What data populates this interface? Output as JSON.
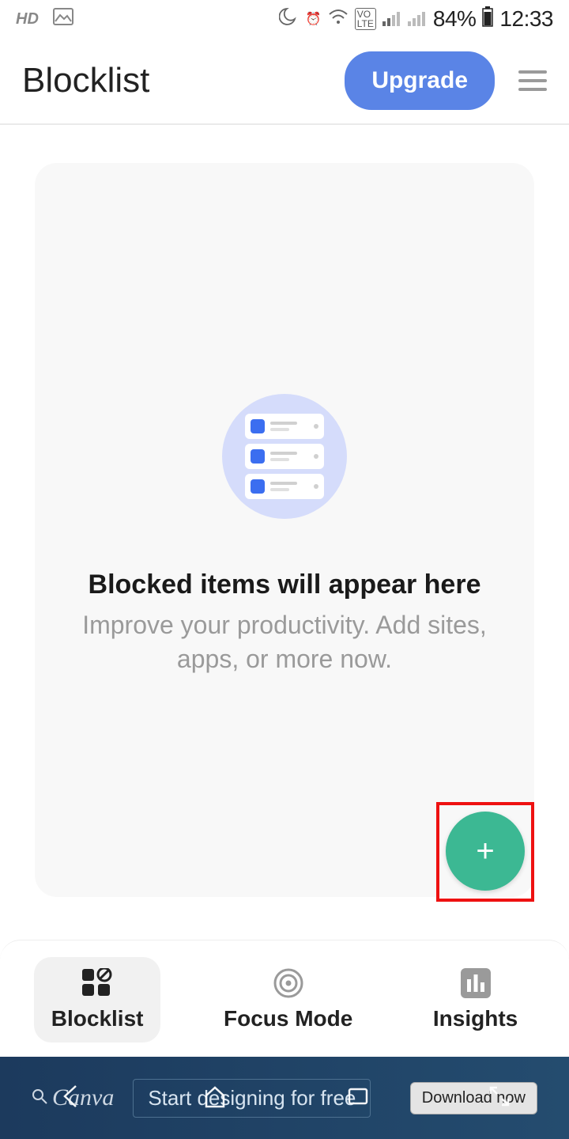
{
  "status_bar": {
    "hd": "HD",
    "battery_pct": "84%",
    "time": "12:33"
  },
  "header": {
    "title": "Blocklist",
    "upgrade_label": "Upgrade"
  },
  "empty_state": {
    "title": "Blocked items will appear here",
    "subtitle": "Improve your productivity. Add sites, apps, or more now."
  },
  "fab": {
    "plus": "+"
  },
  "nav": {
    "items": [
      {
        "label": "Blocklist",
        "active": true
      },
      {
        "label": "Focus Mode",
        "active": false
      },
      {
        "label": "Insights",
        "active": false
      }
    ]
  },
  "ad": {
    "brand": "Canva",
    "text": "Start designing for free",
    "cta": "Download now"
  }
}
